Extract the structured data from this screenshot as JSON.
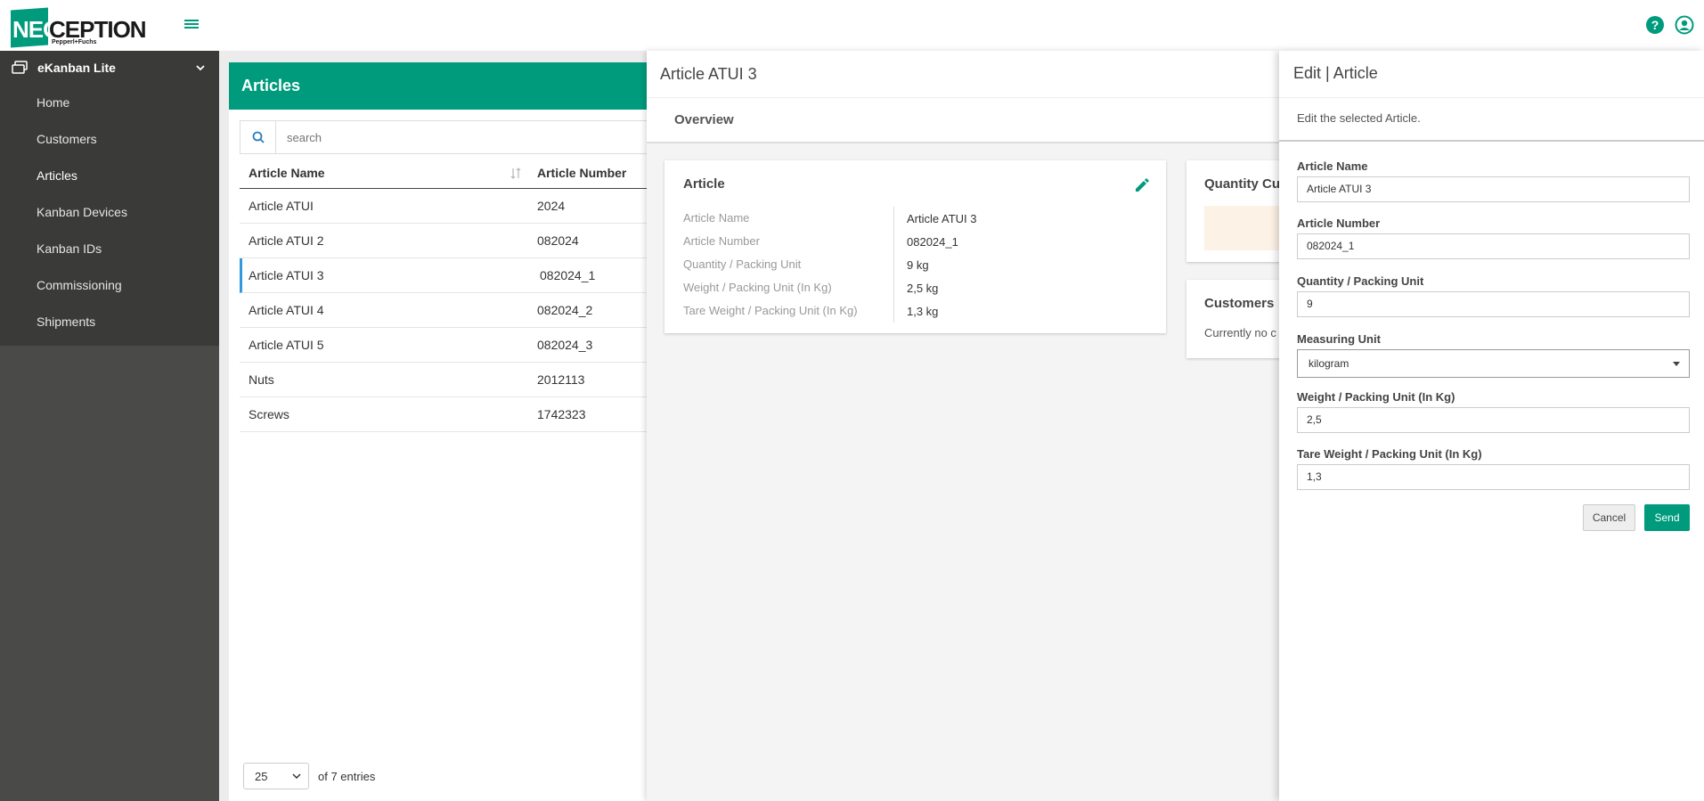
{
  "brand": {
    "logo_neo": "NEO",
    "logo_ception": "CEPTION",
    "logo_sub": "Pepperl+Fuchs",
    "accent": "#009a7c"
  },
  "sidebar": {
    "header": "eKanban Lite",
    "items": [
      {
        "label": "Home"
      },
      {
        "label": "Customers"
      },
      {
        "label": "Articles"
      },
      {
        "label": "Kanban Devices"
      },
      {
        "label": "Kanban IDs"
      },
      {
        "label": "Commissioning"
      },
      {
        "label": "Shipments"
      }
    ]
  },
  "articles": {
    "title": "Articles",
    "search_placeholder": "search",
    "columns": [
      "Article Name",
      "Article Number"
    ],
    "rows": [
      {
        "name": "Article ATUI",
        "number": "2024"
      },
      {
        "name": "Article ATUI 2",
        "number": "082024"
      },
      {
        "name": "Article ATUI 3",
        "number": "082024_1"
      },
      {
        "name": "Article ATUI 4",
        "number": "082024_2"
      },
      {
        "name": "Article ATUI 5",
        "number": "082024_3"
      },
      {
        "name": "Nuts",
        "number": "2012113"
      },
      {
        "name": "Screws",
        "number": "1742323"
      }
    ],
    "page_size": "25",
    "entries_text": "of 7 entries"
  },
  "detail": {
    "title": "Article ATUI 3",
    "tab": "Overview",
    "article_card": {
      "title": "Article",
      "fields": [
        {
          "key": "Article Name",
          "value": "Article ATUI 3"
        },
        {
          "key": "Article Number",
          "value": "082024_1"
        },
        {
          "key": "Quantity / Packing Unit",
          "value": "9 kg"
        },
        {
          "key": "Weight / Packing Unit (In Kg)",
          "value": "2,5 kg"
        },
        {
          "key": "Tare Weight / Packing Unit (In Kg)",
          "value": "1,3 kg"
        }
      ]
    },
    "quantity_card_title": "Quantity Cu",
    "customers_card_title": "Customers",
    "customers_text": "Currently no c"
  },
  "edit": {
    "title": "Edit | Article",
    "description": "Edit the selected Article.",
    "fields": {
      "article_name": {
        "label": "Article Name",
        "value": "Article ATUI 3"
      },
      "article_number": {
        "label": "Article Number",
        "value": "082024_1"
      },
      "quantity": {
        "label": "Quantity / Packing Unit",
        "value": "9"
      },
      "measuring_unit": {
        "label": "Measuring Unit",
        "value": "kilogram"
      },
      "weight": {
        "label": "Weight / Packing Unit (In Kg)",
        "value": "2,5"
      },
      "tare_weight": {
        "label": "Tare Weight / Packing Unit (In Kg)",
        "value": "1,3"
      }
    },
    "cancel_label": "Cancel",
    "send_label": "Send"
  }
}
